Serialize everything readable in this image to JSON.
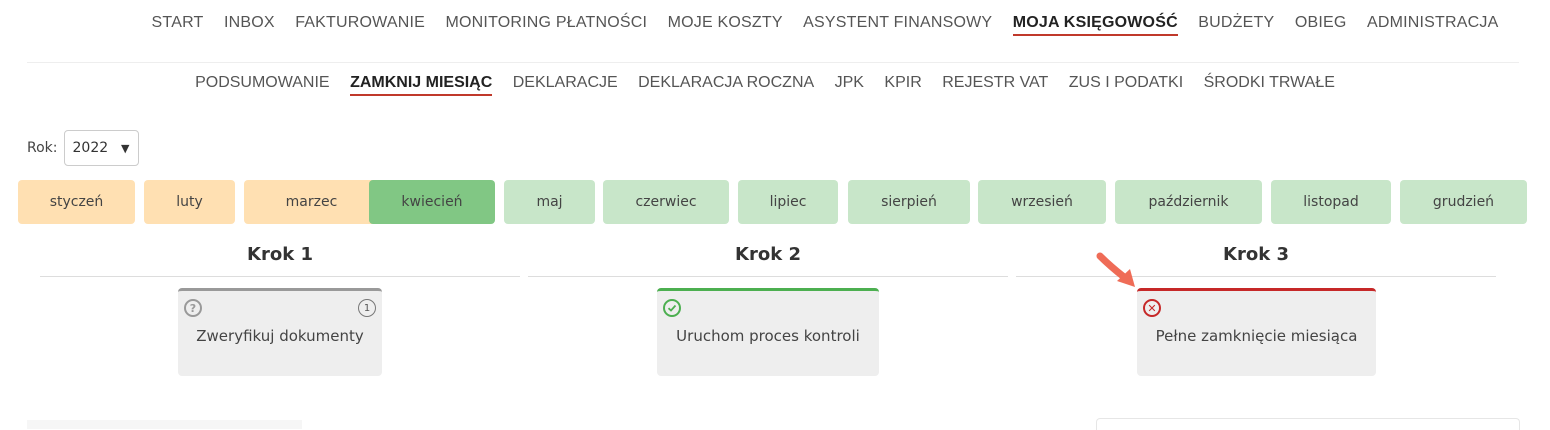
{
  "top_nav": [
    {
      "label": "START"
    },
    {
      "label": "INBOX"
    },
    {
      "label": "FAKTUROWANIE"
    },
    {
      "label": "MONITORING PŁATNOŚCI"
    },
    {
      "label": "MOJE KOSZTY"
    },
    {
      "label": "ASYSTENT FINANSOWY"
    },
    {
      "label": "MOJA KSIĘGOWOŚĆ",
      "active": true
    },
    {
      "label": "BUDŻETY"
    },
    {
      "label": "OBIEG"
    },
    {
      "label": "ADMINISTRACJA"
    }
  ],
  "sub_nav": [
    {
      "label": "PODSUMOWANIE"
    },
    {
      "label": "ZAMKNIJ MIESIĄC",
      "active": true
    },
    {
      "label": "DEKLARACJE"
    },
    {
      "label": "DEKLARACJA ROCZNA"
    },
    {
      "label": "JPK"
    },
    {
      "label": "KPIR"
    },
    {
      "label": "REJESTR VAT"
    },
    {
      "label": "ZUS I PODATKI"
    },
    {
      "label": "ŚRODKI TRWAŁE"
    }
  ],
  "year": {
    "label": "Rok:",
    "value": "2022"
  },
  "months": [
    {
      "label": "styczeń",
      "status": "warning"
    },
    {
      "label": "luty",
      "status": "warning"
    },
    {
      "label": "marzec",
      "status": "warning"
    },
    {
      "label": "kwiecień",
      "status": "selected"
    },
    {
      "label": "maj",
      "status": "open"
    },
    {
      "label": "czerwiec",
      "status": "open"
    },
    {
      "label": "lipiec",
      "status": "open"
    },
    {
      "label": "sierpień",
      "status": "open"
    },
    {
      "label": "wrzesień",
      "status": "open"
    },
    {
      "label": "październik",
      "status": "open"
    },
    {
      "label": "listopad",
      "status": "open"
    },
    {
      "label": "grudzień",
      "status": "open"
    }
  ],
  "steps": [
    {
      "title": "Krok 1",
      "card_label": "Zweryfikuj dokumenty",
      "status": "unknown",
      "icon": "question-icon",
      "count": "1"
    },
    {
      "title": "Krok 2",
      "card_label": "Uruchom proces kontroli",
      "status": "done",
      "icon": "check-circle-icon"
    },
    {
      "title": "Krok 3",
      "card_label": "Pełne zamknięcie miesiąca",
      "status": "error",
      "icon": "x-circle-icon"
    }
  ],
  "colors": {
    "accent_underline": "#c0392b",
    "month_warning": "#ffe0b2",
    "month_selected": "#81c784",
    "month_open": "#c8e6c9",
    "status_done": "#4caf50",
    "status_error": "#c62828",
    "arrow": "#ef6c57"
  }
}
